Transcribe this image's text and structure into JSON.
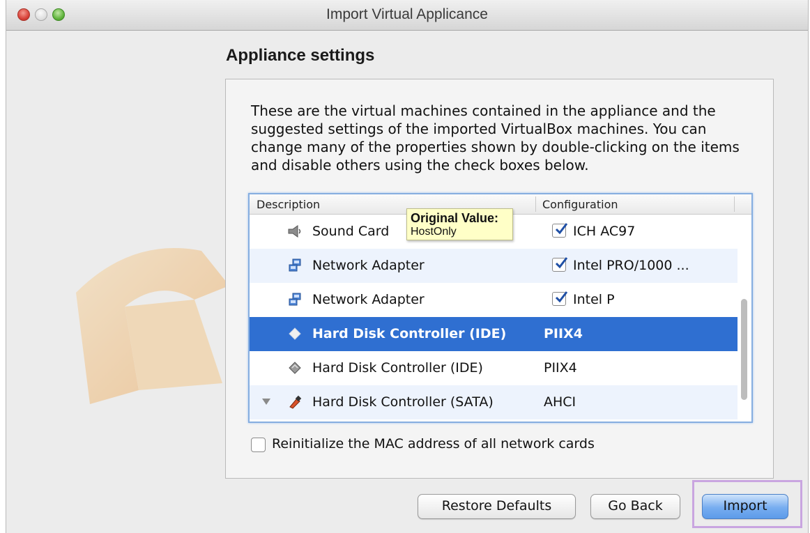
{
  "window": {
    "title": "Import Virtual Applicance"
  },
  "heading": "Appliance settings",
  "description": "These are the virtual machines contained in the appliance and the suggested settings of the imported VirtualBox machines. You can change many of the properties shown by double-clicking on the items and disable others using the check boxes below.",
  "table": {
    "headers": {
      "description": "Description",
      "configuration": "Configuration"
    },
    "rows": [
      {
        "label": "Sound Card",
        "value": "ICH AC97",
        "checked": true,
        "icon": "sound-card-icon"
      },
      {
        "label": "Network Adapter",
        "value": "Intel PRO/1000 ...",
        "checked": true,
        "icon": "network-adapter-icon"
      },
      {
        "label": "Network Adapter",
        "value": "Intel P",
        "checked": true,
        "icon": "network-adapter-icon"
      },
      {
        "label": "Hard Disk Controller (IDE)",
        "value": "PIIX4",
        "selected": true,
        "icon": "disk-controller-icon"
      },
      {
        "label": "Hard Disk Controller (IDE)",
        "value": "PIIX4",
        "icon": "disk-controller-icon"
      },
      {
        "label": "Hard Disk Controller (SATA)",
        "value": "AHCI",
        "expandable": true,
        "icon": "sata-controller-icon"
      }
    ]
  },
  "tooltip": {
    "title": "Original Value:",
    "value": "HostOnly"
  },
  "mac_option": {
    "label": "Reinitialize the MAC address of all network cards",
    "checked": false
  },
  "buttons": {
    "restore": "Restore Defaults",
    "back": "Go Back",
    "import": "Import"
  },
  "colors": {
    "selection": "#2f6fd1",
    "tooltip": "#ffffc7",
    "highlight": "#c9a5e0"
  }
}
